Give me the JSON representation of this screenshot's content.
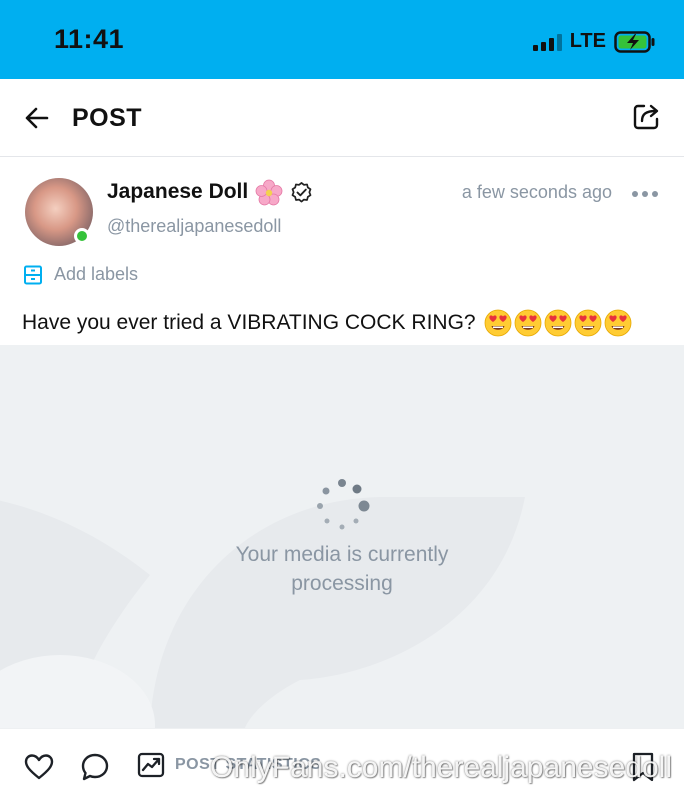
{
  "status_bar": {
    "time": "11:41",
    "network": "LTE",
    "battery_state": "charging",
    "background": "#00aff0"
  },
  "header": {
    "title": "POST",
    "back_icon": "arrow-left-icon",
    "share_icon": "share-icon"
  },
  "post": {
    "author_name": "Japanese Doll",
    "author_handle": "@therealjapanesedoll",
    "timestamp": "a few seconds ago",
    "online": true,
    "verified": true,
    "labels_text": "Add labels",
    "text": "Have you ever tried a VIBRATING COCK RING?",
    "emoji_count": 5,
    "emoji_icon": "heart-eyes-emoji-icon",
    "media_status": "Your media is currently processing"
  },
  "actions": {
    "stats_label": "POST STATISTICS"
  },
  "watermark": "OnlyFans.com/therealjapanesedoll",
  "colors": {
    "brand": "#00aff0",
    "muted": "#8a96a3",
    "online": "#35c23a"
  }
}
